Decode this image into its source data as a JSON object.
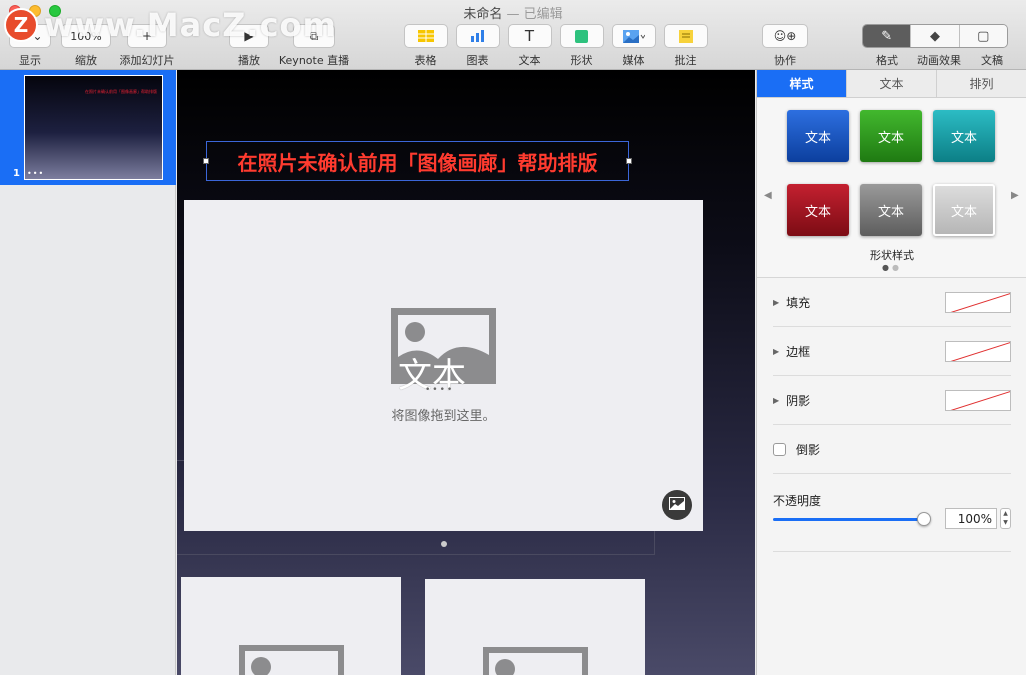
{
  "window": {
    "title": "未命名",
    "subtitle": "— 已编辑"
  },
  "watermark": {
    "logo": "Z",
    "text": "www.MacZ.com"
  },
  "toolbar": {
    "view_label": "显示",
    "zoom_value": "100%",
    "zoom_label": "缩放",
    "add_slide_label": "添加幻灯片",
    "play_label": "播放",
    "keynote_live_label": "Keynote 直播",
    "table_label": "表格",
    "chart_label": "图表",
    "text_label": "文本",
    "shape_label": "形状",
    "media_label": "媒体",
    "comment_label": "批注",
    "collaborate_label": "协作",
    "format_label": "格式",
    "animate_label": "动画效果",
    "document_label": "文稿"
  },
  "navigator": {
    "slides": [
      {
        "number": "1",
        "thumb_text": "在照片未确认前用「图像画廊」帮助排版",
        "dots": "•••"
      }
    ]
  },
  "slide": {
    "title": "在照片未确认前用「图像画廊」帮助排版",
    "placeholder_overlay_text": "文本",
    "placeholder_dots": "••••",
    "placeholder_caption": "将图像拖到这里。"
  },
  "inspector": {
    "tabs": [
      "样式",
      "文本",
      "排列"
    ],
    "active_tab": "样式",
    "style_swatches": [
      {
        "label": "文本",
        "color": "#1a56c4"
      },
      {
        "label": "文本",
        "color": "#2e9a1e"
      },
      {
        "label": "文本",
        "color": "#16a0a8"
      },
      {
        "label": "文本",
        "color": "#a8121c"
      },
      {
        "label": "文本",
        "color": "#7c7c7c"
      },
      {
        "label": "文本",
        "color": "#c9c9c9"
      }
    ],
    "styles_caption": "形状样式",
    "fill_label": "填充",
    "border_label": "边框",
    "shadow_label": "阴影",
    "reflection_label": "倒影",
    "opacity_label": "不透明度",
    "opacity_value": "100%",
    "opacity_level": 1.0
  },
  "colors": {
    "accent": "#1a6ef5",
    "title_red": "#ff3b2f"
  }
}
